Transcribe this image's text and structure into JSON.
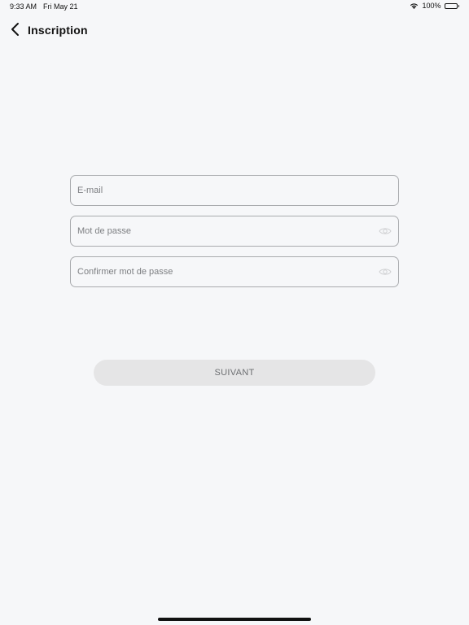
{
  "status_bar": {
    "time": "9:33 AM",
    "date": "Fri May 21",
    "battery": "100%",
    "wifi_icon": "wifi-icon",
    "battery_icon": "battery-icon"
  },
  "header": {
    "back_icon": "chevron-left-icon",
    "title": "Inscription"
  },
  "form": {
    "email": {
      "placeholder": "E-mail",
      "value": ""
    },
    "password": {
      "placeholder": "Mot de passe",
      "value": "",
      "toggle_icon": "eye-icon"
    },
    "confirm_password": {
      "placeholder": "Confirmer mot de passe",
      "value": "",
      "toggle_icon": "eye-icon"
    }
  },
  "actions": {
    "next_label": "SUIVANT"
  },
  "colors": {
    "background": "#f6f7f9",
    "field_border": "#a9abae",
    "button_bg": "#e5e5e6",
    "button_text": "#6d6f72"
  }
}
